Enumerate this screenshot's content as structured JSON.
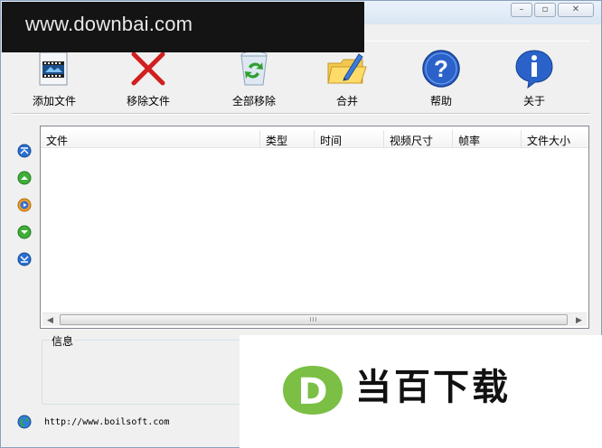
{
  "watermark": {
    "text": "www.downbai.com"
  },
  "window_controls": {
    "minimize": "–",
    "maximize": "▫",
    "close": "✕"
  },
  "toolbar": {
    "add_file": "添加文件",
    "remove_file": "移除文件",
    "remove_all": "全部移除",
    "merge": "合并",
    "help": "帮助",
    "about": "关于"
  },
  "table": {
    "columns": [
      "文件",
      "类型",
      "时间",
      "视频尺寸",
      "帧率",
      "文件大小"
    ]
  },
  "scrollbar": {
    "left": "◀",
    "right": "▶",
    "grip": "III"
  },
  "info": {
    "label": "信息"
  },
  "footer": {
    "url": "http://www.boilsoft.com"
  },
  "brand": {
    "letter": "D",
    "text": "当百下载"
  },
  "colors": {
    "watermark_bg": "#141414",
    "brand_green": "#7bbf45",
    "help_blue": "#2a62c9",
    "remove_red": "#d11f1f"
  }
}
